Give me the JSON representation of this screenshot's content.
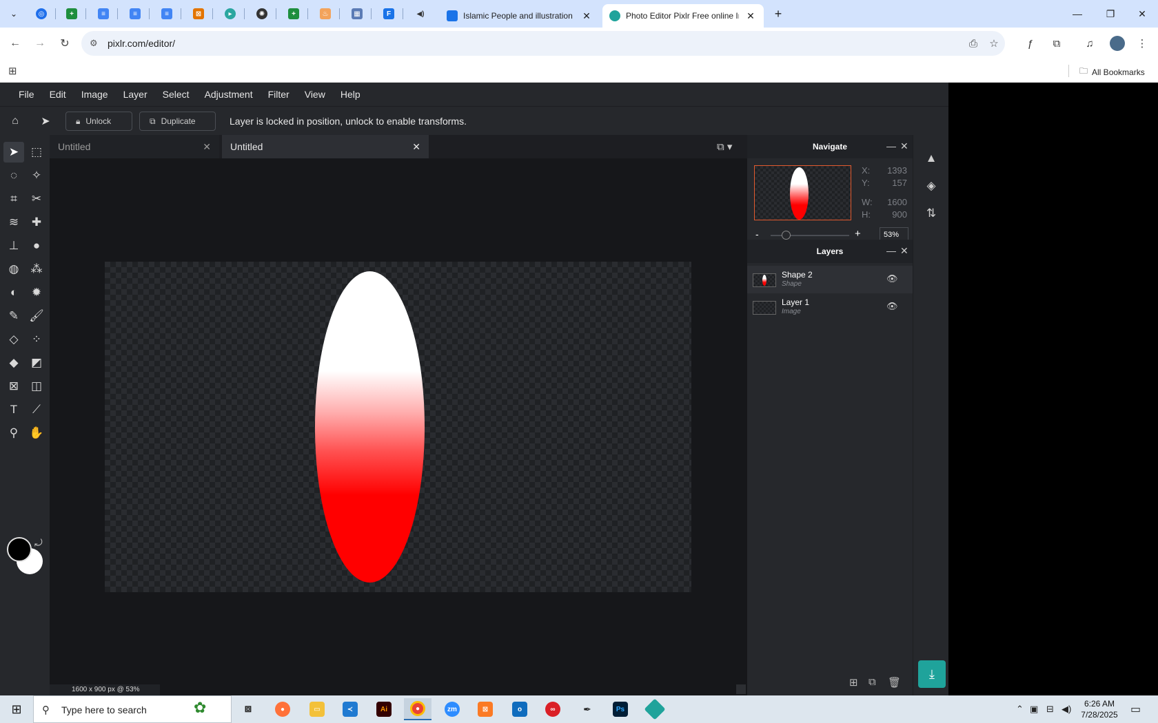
{
  "browser": {
    "tabs": [
      {
        "title": "Islamic People and illustration v",
        "icon": "document-icon"
      },
      {
        "title": "Photo Editor Pixlr Free online Im",
        "icon": "pixlr-icon"
      }
    ],
    "url": "pixlr.com/editor/",
    "bookmarks_all": "All Bookmarks"
  },
  "pixlr": {
    "menu": [
      "File",
      "Edit",
      "Image",
      "Layer",
      "Select",
      "Adjustment",
      "Filter",
      "View",
      "Help"
    ],
    "options": {
      "unlock_label": "Unlock",
      "duplicate_label": "Duplicate",
      "message": "Layer is locked in position, unlock to enable transforms."
    },
    "doc_tabs": [
      {
        "name": "Untitled",
        "active": false
      },
      {
        "name": "Untitled",
        "active": true
      }
    ],
    "status": "1600 x 900 px @ 53%",
    "navigate": {
      "title": "Navigate",
      "x_label": "X:",
      "x": "1393",
      "y_label": "Y:",
      "y": "157",
      "w_label": "W:",
      "w": "1600",
      "h_label": "H:",
      "h": "900",
      "zoom_minus": "-",
      "zoom_plus": "+",
      "zoom": "53%"
    },
    "layers": {
      "title": "Layers",
      "items": [
        {
          "name": "Shape 2",
          "type": "Shape"
        },
        {
          "name": "Layer 1",
          "type": "Image"
        }
      ]
    },
    "colors": {
      "foreground": "#000000",
      "background": "#ffffff",
      "accent": "#1fa39b"
    }
  },
  "taskbar": {
    "search_placeholder": "Type here to search",
    "time": "6:26 AM",
    "date": "7/28/2025"
  }
}
